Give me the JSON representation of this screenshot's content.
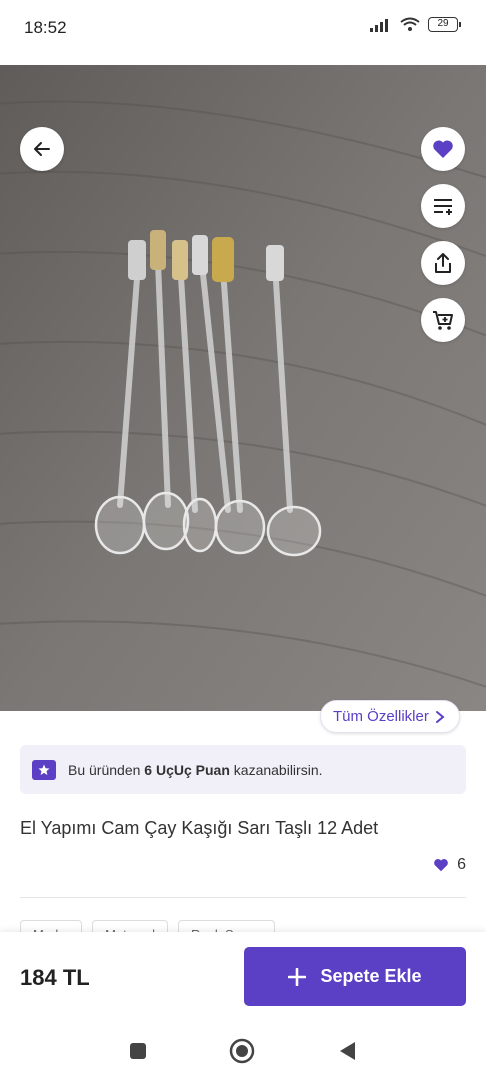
{
  "status_bar": {
    "time": "18:52",
    "battery": "29"
  },
  "product": {
    "title": "El Yapımı Cam Çay Kaşığı Sarı Taşlı 12 Adet",
    "like_count": "6",
    "price": "184 TL",
    "all_features_label": "Tüm Özellikler",
    "points_banner": {
      "prefix": "Bu üründen",
      "points": "6 UçUç Puan",
      "suffix": "kazanabilirsin."
    },
    "tags": [
      "Marka",
      "Materyal",
      "Renk Seçen"
    ]
  },
  "actions": {
    "add_to_cart_label": "Sepete Ekle"
  },
  "colors": {
    "accent": "#5b3fc4",
    "banner_bg": "#f1eff8"
  },
  "icons": {
    "back": "arrow-left-icon",
    "favorite": "heart-icon",
    "filter": "filter-list-icon",
    "share": "share-icon",
    "cart": "cart-icon",
    "nav_recent": "square-icon",
    "nav_home": "circle-icon",
    "nav_back": "triangle-back-icon"
  }
}
